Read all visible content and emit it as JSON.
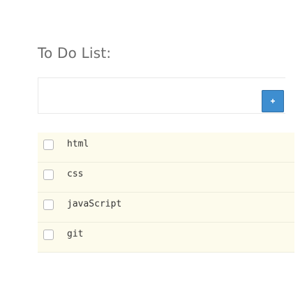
{
  "header": {
    "title": "To Do List:"
  },
  "form": {
    "input_value": "",
    "input_placeholder": "",
    "add_button_icon": "plus-icon"
  },
  "colors": {
    "accent": "#3e8ed0",
    "list_background": "#fdfbec",
    "title": "#6c6c6c"
  },
  "todos": [
    {
      "text": "html",
      "checked": false
    },
    {
      "text": "css",
      "checked": false
    },
    {
      "text": "javaScript",
      "checked": false
    },
    {
      "text": "git",
      "checked": false
    }
  ]
}
